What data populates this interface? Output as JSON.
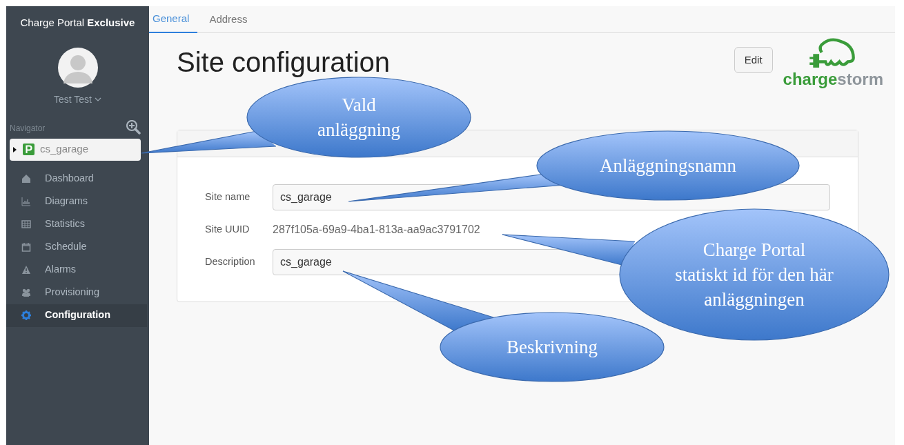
{
  "brand": {
    "text": "Charge Portal",
    "bold": "Exclusive"
  },
  "user": {
    "name": "Test Test"
  },
  "navigator": {
    "label": "Navigator",
    "sites": [
      {
        "label": "cs_garage",
        "expanded": false,
        "selected": true
      }
    ]
  },
  "nav_items": [
    {
      "label": "Dashboard",
      "selected": false
    },
    {
      "label": "Diagrams",
      "selected": false
    },
    {
      "label": "Statistics",
      "selected": false
    },
    {
      "label": "Schedule",
      "selected": false
    },
    {
      "label": "Alarms",
      "selected": false
    },
    {
      "label": "Provisioning",
      "selected": false
    },
    {
      "label": "Configuration",
      "selected": true
    }
  ],
  "tabs": [
    {
      "label": "General",
      "selected": true
    },
    {
      "label": "Address",
      "selected": false
    }
  ],
  "title": "Site configuration",
  "edit_button": "Edit",
  "logo": {
    "first": "charge",
    "second": "storm"
  },
  "fields": [
    {
      "label": "Site name",
      "kind": "input",
      "value": "cs_garage"
    },
    {
      "label": "Site UUID",
      "kind": "text",
      "value": "287f105a-69a9-4ba1-813a-aa9ac3791702"
    },
    {
      "label": "Description",
      "kind": "input",
      "value": "cs_garage"
    }
  ],
  "callouts": [
    {
      "text": "Vald anläggning"
    },
    {
      "text": "Anläggningsnamn"
    },
    {
      "text": "Charge Portal statiskt id för den här anläggningen"
    },
    {
      "text": "Beskrivning"
    }
  ]
}
